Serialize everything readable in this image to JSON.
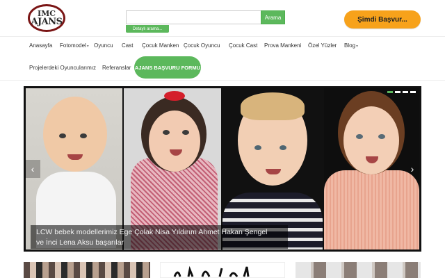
{
  "logo": {
    "line1": "IMC",
    "line2": "AJANS"
  },
  "search": {
    "placeholder": "",
    "button_label": "Arama",
    "detail_label": "Detaylı arama..."
  },
  "header": {
    "apply_label": "Şimdi Başvur..."
  },
  "nav": {
    "items": [
      {
        "label": "Anasayfa",
        "caret": ""
      },
      {
        "label": "Fotomodel",
        "caret": "▾"
      },
      {
        "label": "Oyuncu",
        "caret": ""
      },
      {
        "label": "Cast",
        "caret": ""
      },
      {
        "label": "Çocuk Manken",
        "caret": ""
      },
      {
        "label": "Çocuk Oyuncu",
        "caret": ""
      },
      {
        "label": "Çocuk Cast",
        "caret": ""
      },
      {
        "label": "Prova Mankeni",
        "caret": ""
      },
      {
        "label": "Özel Yüzler",
        "caret": ""
      },
      {
        "label": "Blog",
        "caret": "▾"
      },
      {
        "label": "Projelerdeki Oyuncularımız",
        "caret": ""
      },
      {
        "label": "Referanslar",
        "caret": ""
      }
    ],
    "cta_label": "AJANS BAŞVURU FORMU"
  },
  "slider": {
    "caption_line1": "LCW bebek modellerimiz Ege Çolak Nisa Yıldırım Ahmet Hakan Şengel",
    "caption_line2": "ve İnci Lena Aksu başarılar",
    "prev": "‹",
    "next": "›",
    "slide_count": 4,
    "active_slide": 1
  },
  "colors": {
    "green": "#5cb85c",
    "orange": "#f7a21b",
    "logo_ring": "#7a1515"
  }
}
